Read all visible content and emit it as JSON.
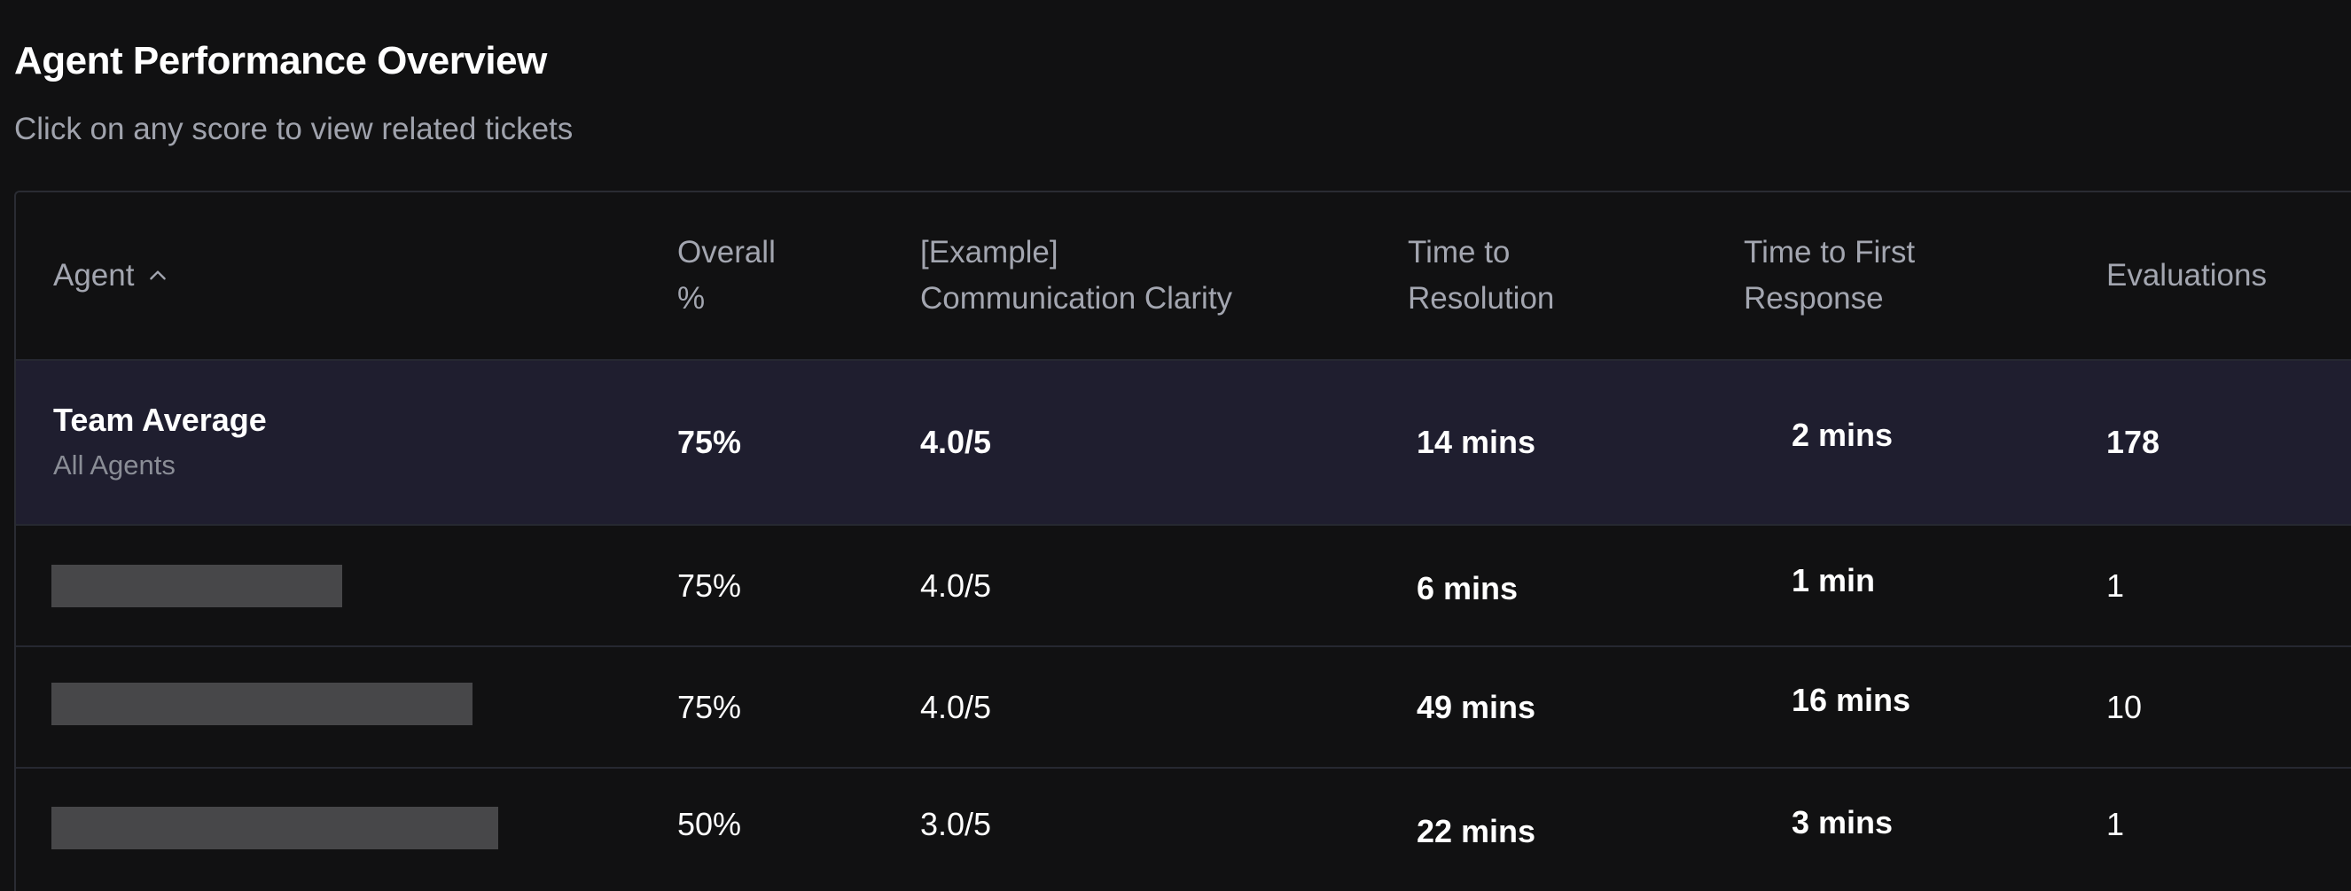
{
  "page": {
    "title": "Agent Performance Overview",
    "subtitle": "Click on any score to view related tickets"
  },
  "table": {
    "columns": [
      {
        "key": "agent",
        "label": "Agent",
        "sort": "ascending"
      },
      {
        "key": "overall",
        "label_line1": "Overall",
        "label_line2": "%"
      },
      {
        "key": "clarity",
        "label_line1": "[Example]",
        "label_line2": "Communication Clarity"
      },
      {
        "key": "resolution",
        "label_line1": "Time to",
        "label_line2": "Resolution"
      },
      {
        "key": "first_response",
        "label_line1": "Time to First",
        "label_line2": "Response"
      },
      {
        "key": "evaluations",
        "label": "Evaluations"
      }
    ],
    "sort_icon": "chevron-up-icon",
    "team_average": {
      "name": "Team Average",
      "subtitle": "All Agents",
      "overall": "75%",
      "clarity": "4.0/5",
      "resolution": "14 mins",
      "first_response": "2 mins",
      "evaluations": "178"
    },
    "rows": [
      {
        "agent_redacted": true,
        "overall": "75%",
        "clarity": "4.0/5",
        "resolution": "6 mins",
        "first_response": "1 min",
        "evaluations": "1"
      },
      {
        "agent_redacted": true,
        "overall": "75%",
        "clarity": "4.0/5",
        "resolution": "49 mins",
        "first_response": "16 mins",
        "evaluations": "10"
      },
      {
        "agent_redacted": true,
        "overall": "50%",
        "clarity": "3.0/5",
        "resolution": "22 mins",
        "first_response": "3 mins",
        "evaluations": "1"
      }
    ]
  },
  "colors": {
    "background": "#111112",
    "team_row": "#1f1e2f",
    "border": "#262831",
    "header_text": "#a3a6b0",
    "redaction": "#474749"
  }
}
